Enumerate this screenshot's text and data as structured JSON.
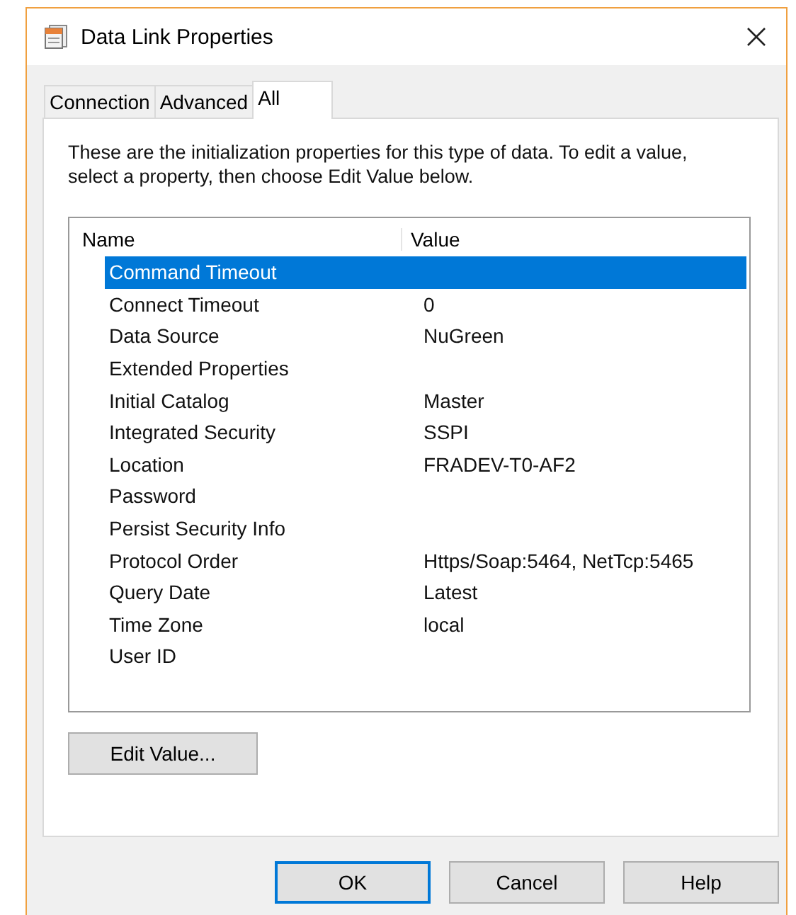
{
  "window": {
    "title": "Data Link Properties"
  },
  "tabs": [
    {
      "label": "Connection",
      "selected": false
    },
    {
      "label": "Advanced",
      "selected": false
    },
    {
      "label": "All",
      "selected": true
    }
  ],
  "description": "These are the initialization properties for this type of data. To edit a value, select a property, then choose Edit Value below.",
  "table": {
    "columns": [
      "Name",
      "Value"
    ],
    "rows": [
      {
        "name": "Command Timeout",
        "selected": true
      },
      {
        "name": "Connect Timeout",
        "value": "0",
        "selected": false
      },
      {
        "name": "Data Source",
        "value": "NuGreen",
        "selected": false
      },
      {
        "name": "Extended Properties",
        "selected": false
      },
      {
        "name": "Initial Catalog",
        "value": "Master",
        "selected": false
      },
      {
        "name": "Integrated Security",
        "value": "SSPI",
        "selected": false
      },
      {
        "name": "Location",
        "value": "FRADEV-T0-AF2",
        "selected": false
      },
      {
        "name": "Password",
        "selected": false
      },
      {
        "name": "Persist Security Info",
        "selected": false
      },
      {
        "name": "Protocol Order",
        "value": "Https/Soap:5464, NetTcp:5465",
        "selected": false
      },
      {
        "name": "Query Date",
        "value": "Latest",
        "selected": false
      },
      {
        "name": "Time Zone",
        "value": "local",
        "selected": false
      },
      {
        "name": "User ID",
        "selected": false
      }
    ]
  },
  "edit_button": "Edit Value...",
  "buttons": [
    {
      "label": "OK",
      "default": true
    },
    {
      "label": "Cancel",
      "default": false
    },
    {
      "label": "Help",
      "default": false
    }
  ]
}
